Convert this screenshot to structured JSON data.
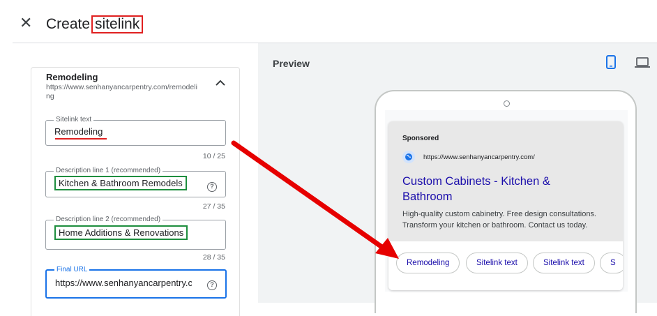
{
  "header": {
    "close_icon": "close-icon",
    "title_prefix": "Create",
    "title_highlight": "sitelink"
  },
  "editor": {
    "card_title": "Remodeling",
    "card_url": "https://www.senhanyancarpentry.com/remodeling",
    "collapse_icon": "chevron-up-icon",
    "fields": {
      "sitelink_text": {
        "label": "Sitelink text",
        "value": "Remodeling",
        "counter": "10 / 25"
      },
      "description1": {
        "label": "Description line 1 (recommended)",
        "value": "Kitchen & Bathroom Remodels",
        "counter": "27 / 35",
        "help_icon": "help-icon"
      },
      "description2": {
        "label": "Description line 2 (recommended)",
        "value": "Home Additions & Renovations",
        "counter": "28 / 35"
      },
      "final_url": {
        "label": "Final URL",
        "value": "https://www.senhanyancarpentry.com/remodeling",
        "help_icon": "help-icon"
      }
    }
  },
  "preview": {
    "label": "Preview",
    "device_icons": [
      "mobile-icon",
      "laptop-icon"
    ],
    "ad": {
      "sponsored": "Sponsored",
      "url": "https://www.senhanyancarpentry.com/",
      "headline": "Custom Cabinets - Kitchen & Bathroom",
      "description": "High-quality custom cabinetry. Free design consultations. Transform your kitchen or bathroom. Contact us today.",
      "sitelinks": [
        "Remodeling",
        "Sitelink text",
        "Sitelink text",
        "S"
      ]
    }
  },
  "annotations": {
    "highlight_color": "#e02020",
    "field_box_color": "#1e8e3e",
    "arrow_color": "#e02020"
  }
}
